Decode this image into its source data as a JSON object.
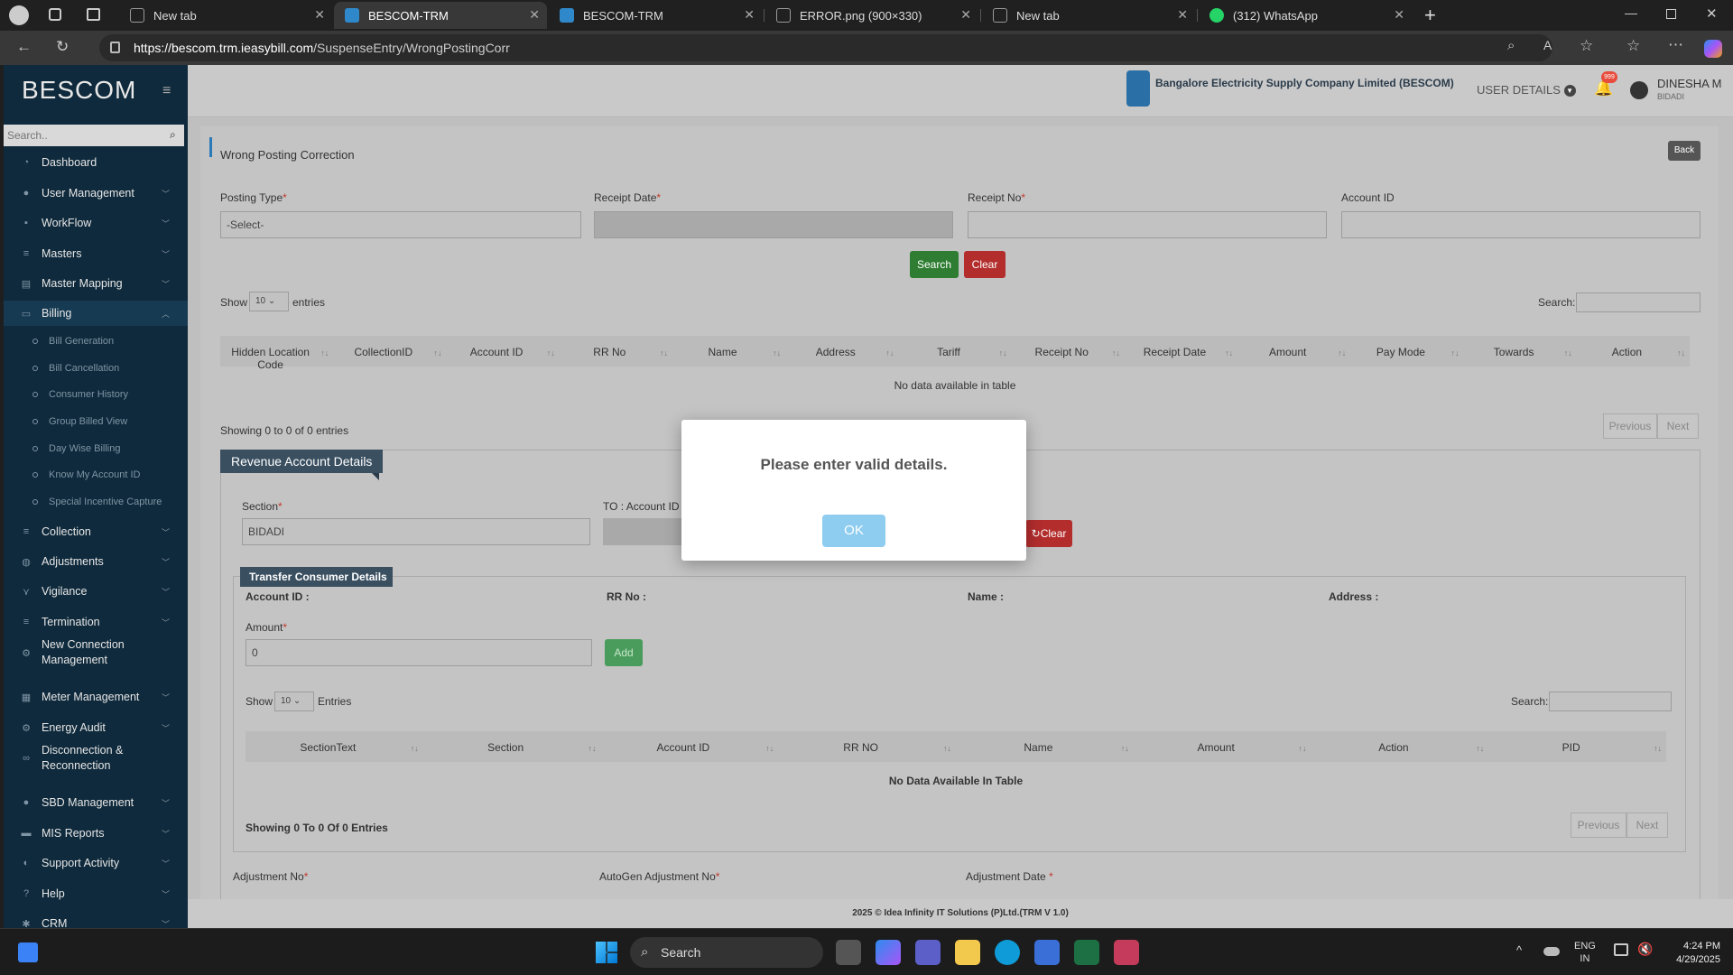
{
  "browser": {
    "tabs": [
      {
        "title": "New tab",
        "active": false
      },
      {
        "title": "BESCOM-TRM",
        "active": true
      },
      {
        "title": "BESCOM-TRM",
        "active": false
      },
      {
        "title": "ERROR.png (900×330)",
        "active": false
      },
      {
        "title": "New tab",
        "active": false
      },
      {
        "title": "(312) WhatsApp",
        "active": false
      }
    ],
    "url_host": "https://bescom.trm.ieasybill.com",
    "url_path": "/SuspenseEntry/WrongPostingCorr"
  },
  "sidebar": {
    "logo": "BESCOM",
    "search_placeholder": "Search..",
    "items": [
      {
        "label": "Dashboard",
        "icon": "dashboard-icon",
        "has_chev": false
      },
      {
        "label": "User Management",
        "icon": "user-icon",
        "has_chev": true
      },
      {
        "label": "WorkFlow",
        "icon": "workflow-icon",
        "has_chev": true
      },
      {
        "label": "Masters",
        "icon": "list-icon",
        "has_chev": true
      },
      {
        "label": "Master Mapping",
        "icon": "mapping-icon",
        "has_chev": true
      },
      {
        "label": "Billing",
        "icon": "monitor-icon",
        "has_chev": true,
        "active": true
      },
      {
        "label": "Collection",
        "icon": "list-icon",
        "has_chev": true
      },
      {
        "label": "Adjustments",
        "icon": "users-icon",
        "has_chev": true
      },
      {
        "label": "Vigilance",
        "icon": "vigilance-icon",
        "has_chev": true
      },
      {
        "label": "Termination",
        "icon": "list-icon",
        "has_chev": true
      },
      {
        "label": "New Connection Management",
        "icon": "gear-icon",
        "has_chev": false
      },
      {
        "label": "Meter Management",
        "icon": "meter-icon",
        "has_chev": true
      },
      {
        "label": "Energy Audit",
        "icon": "audit-icon",
        "has_chev": true
      },
      {
        "label": "Disconnection & Reconnection",
        "icon": "link-icon",
        "has_chev": false
      },
      {
        "label": "SBD Management",
        "icon": "user-icon",
        "has_chev": true
      },
      {
        "label": "MIS Reports",
        "icon": "report-icon",
        "has_chev": true
      },
      {
        "label": "Support Activity",
        "icon": "support-icon",
        "has_chev": true
      },
      {
        "label": "Help",
        "icon": "help-icon",
        "has_chev": true
      },
      {
        "label": "CRM",
        "icon": "crm-icon",
        "has_chev": true
      }
    ],
    "billing_sub": [
      "Bill Generation",
      "Bill Cancellation",
      "Consumer History",
      "Group Billed View",
      "Day Wise Billing",
      "Know My Account ID",
      "Special Incentive Capture"
    ]
  },
  "header": {
    "company": "Bangalore Electricity Supply Company Limited (BESCOM)",
    "user_details": "USER DETAILS",
    "notif_count": "999",
    "user_name": "DINESHA M",
    "user_loc": "BIDADI"
  },
  "page": {
    "title": "Wrong Posting Correction",
    "back": "Back",
    "posting_type_label": "Posting Type",
    "posting_type_value": "-Select-",
    "receipt_date_label": "Receipt Date",
    "receipt_no_label": "Receipt No",
    "account_id_label": "Account ID",
    "search_btn": "Search",
    "clear_btn": "Clear",
    "show": "Show",
    "entries_sel": "10",
    "entries": "entries",
    "search_label": "Search:",
    "columns": [
      "Hidden Location Code",
      "CollectionID",
      "Account ID",
      "RR No",
      "Name",
      "Address",
      "Tariff",
      "Receipt No",
      "Receipt Date",
      "Amount",
      "Pay Mode",
      "Towards",
      "Action"
    ],
    "no_data": "No data available in table",
    "showing": "Showing 0 to 0 of 0 entries",
    "previous": "Previous",
    "next": "Next"
  },
  "revenue": {
    "title": "Revenue Account Details",
    "section_label": "Section",
    "section_value": "BIDADI",
    "to_label": "TO : Account ID /",
    "clear_btn": "Clear",
    "transfer_title": "Transfer Consumer Details",
    "account_id": "Account ID :",
    "rr_no": "RR No :",
    "name": "Name :",
    "address": "Address :",
    "amount_label": "Amount",
    "amount_value": "0",
    "add_btn": "Add",
    "show": "Show",
    "entries_sel": "10",
    "entries": "Entries",
    "search_label": "Search:",
    "columns": [
      "SectionText",
      "Section",
      "Account ID",
      "RR NO",
      "Name",
      "Amount",
      "Action",
      "PID"
    ],
    "no_data": "No Data Available In Table",
    "showing": "Showing 0 To 0 Of 0 Entries",
    "previous": "Previous",
    "next": "Next",
    "adjustment_no": "Adjustment No",
    "autogen_no": "AutoGen Adjustment No",
    "adjustment_date": "Adjustment Date"
  },
  "footer": "2025 © Idea Infinity IT Solutions (P)Ltd.(TRM V 1.0)",
  "modal": {
    "message": "Please enter valid details.",
    "ok": "OK"
  },
  "taskbar": {
    "search": "Search",
    "lang1": "ENG",
    "lang2": "IN",
    "time": "4:24 PM",
    "date": "4/29/2025"
  }
}
